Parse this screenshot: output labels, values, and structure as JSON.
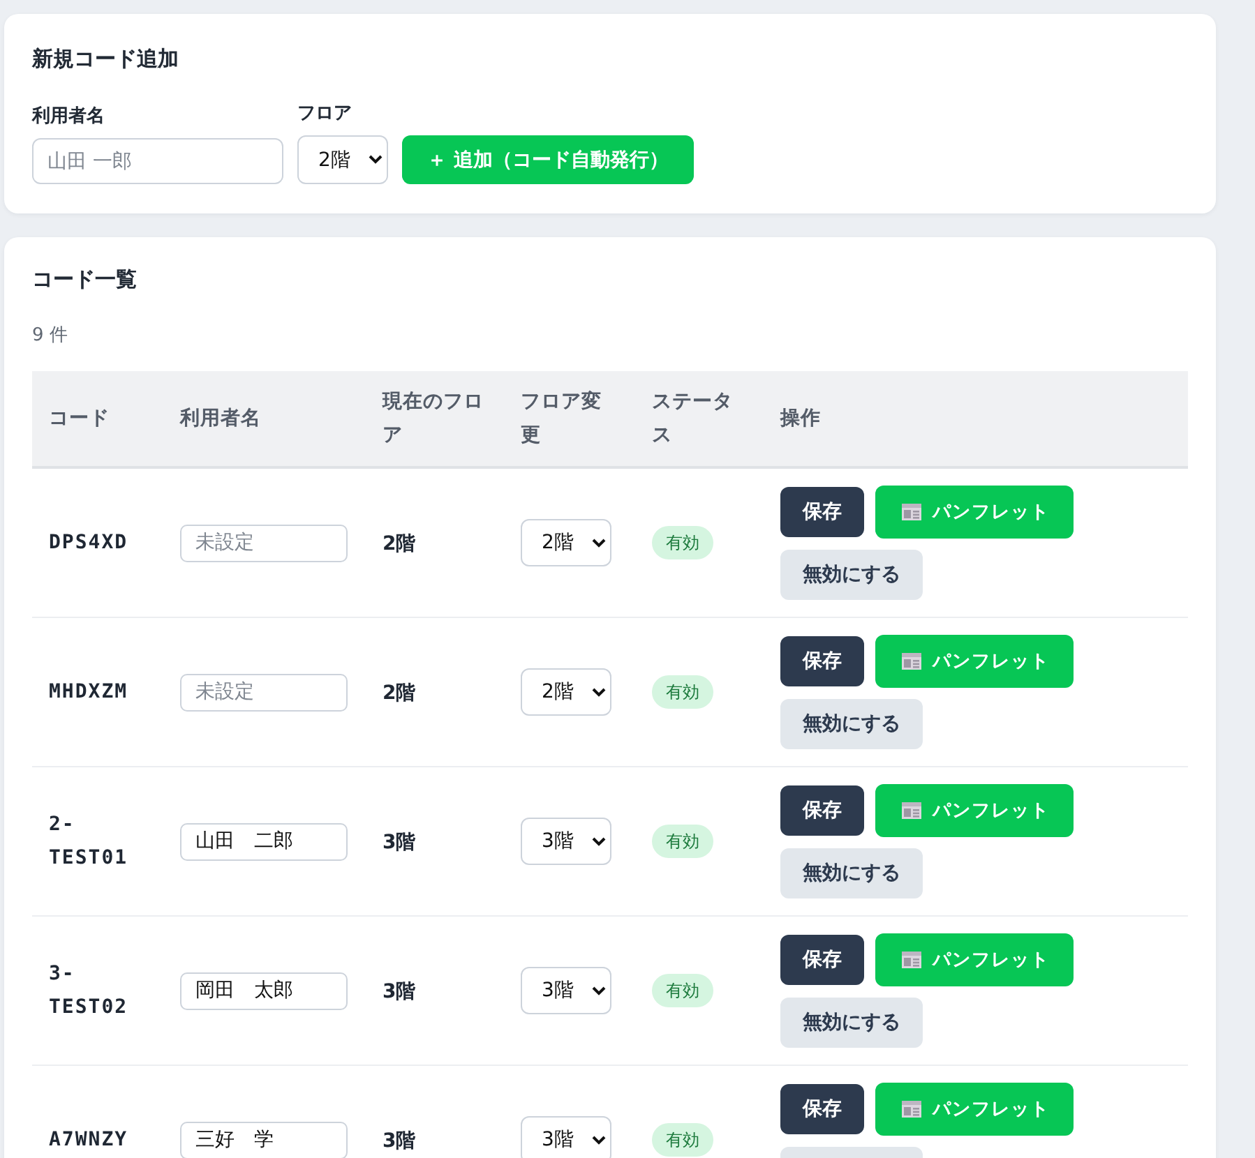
{
  "new_code_form": {
    "title": "新規コード追加",
    "name_field": {
      "label": "利用者名",
      "placeholder": "山田 一郎"
    },
    "floor_field": {
      "label": "フロア",
      "value": "2階"
    },
    "add_button": "＋ 追加（コード自動発行）"
  },
  "code_list": {
    "title": "コード一覧",
    "count": "9 件",
    "columns": [
      "コード",
      "利用者名",
      "現在のフロア",
      "フロア変更",
      "ステータス",
      "操作"
    ],
    "rows": [
      {
        "code": "DPS4XD",
        "name": {
          "placeholder": "未設定"
        },
        "current_floor": "2階",
        "floor_select": "2階",
        "status": {
          "label": "有効",
          "kind": "active"
        },
        "actions": [
          {
            "kind": "save",
            "label": "保存"
          },
          {
            "kind": "pamphlet",
            "label": "パンフレット"
          },
          {
            "kind": "disable",
            "label": "無効にする"
          }
        ]
      },
      {
        "code": "MHDXZM",
        "name": {
          "placeholder": "未設定"
        },
        "current_floor": "2階",
        "floor_select": "2階",
        "status": {
          "label": "有効",
          "kind": "active"
        },
        "actions": [
          {
            "kind": "save",
            "label": "保存"
          },
          {
            "kind": "pamphlet",
            "label": "パンフレット"
          },
          {
            "kind": "disable",
            "label": "無効にする"
          }
        ]
      },
      {
        "code": "2-TEST01",
        "name": {
          "value": "山田　二郎"
        },
        "current_floor": "3階",
        "floor_select": "3階",
        "status": {
          "label": "有効",
          "kind": "active"
        },
        "actions": [
          {
            "kind": "save",
            "label": "保存"
          },
          {
            "kind": "pamphlet",
            "label": "パンフレット"
          },
          {
            "kind": "disable",
            "label": "無効にする"
          }
        ]
      },
      {
        "code": "3-TEST02",
        "name": {
          "value": "岡田　太郎"
        },
        "current_floor": "3階",
        "floor_select": "3階",
        "status": {
          "label": "有効",
          "kind": "active"
        },
        "actions": [
          {
            "kind": "save",
            "label": "保存"
          },
          {
            "kind": "pamphlet",
            "label": "パンフレット"
          },
          {
            "kind": "disable",
            "label": "無効にする"
          }
        ]
      },
      {
        "code": "A7WNZY",
        "name": {
          "value": "三好　学"
        },
        "current_floor": "3階",
        "floor_select": "3階",
        "status": {
          "label": "有効",
          "kind": "active"
        },
        "actions": [
          {
            "kind": "save",
            "label": "保存"
          },
          {
            "kind": "pamphlet",
            "label": "パンフレット"
          },
          {
            "kind": "disable"
          }
        ]
      }
    ]
  }
}
